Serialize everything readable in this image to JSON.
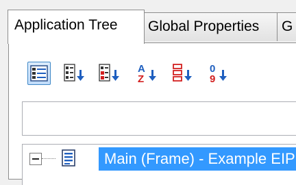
{
  "tabs": [
    {
      "label": "Application Tree",
      "active": true
    },
    {
      "label": "Global Properties",
      "active": false
    },
    {
      "label": "G",
      "active": false
    }
  ],
  "toolbar": {
    "buttons": [
      {
        "icon": "categorized-view-icon",
        "selected": true
      },
      {
        "icon": "sort-by-type-icon",
        "selected": false
      },
      {
        "icon": "sort-by-category-icon",
        "selected": false
      },
      {
        "icon": "sort-alphabetical-icon",
        "selected": false
      },
      {
        "icon": "sort-by-hierarchy-icon",
        "selected": false
      },
      {
        "icon": "sort-numeric-icon",
        "selected": false
      }
    ]
  },
  "search": {
    "value": "",
    "placeholder": ""
  },
  "tree": {
    "root": {
      "label": "Main (Frame) - Example EIP",
      "expanded": true,
      "selected": true
    }
  },
  "colors": {
    "selection": "#3399ff",
    "accent_blue": "#1f5fbf",
    "accent_red": "#d32020"
  }
}
